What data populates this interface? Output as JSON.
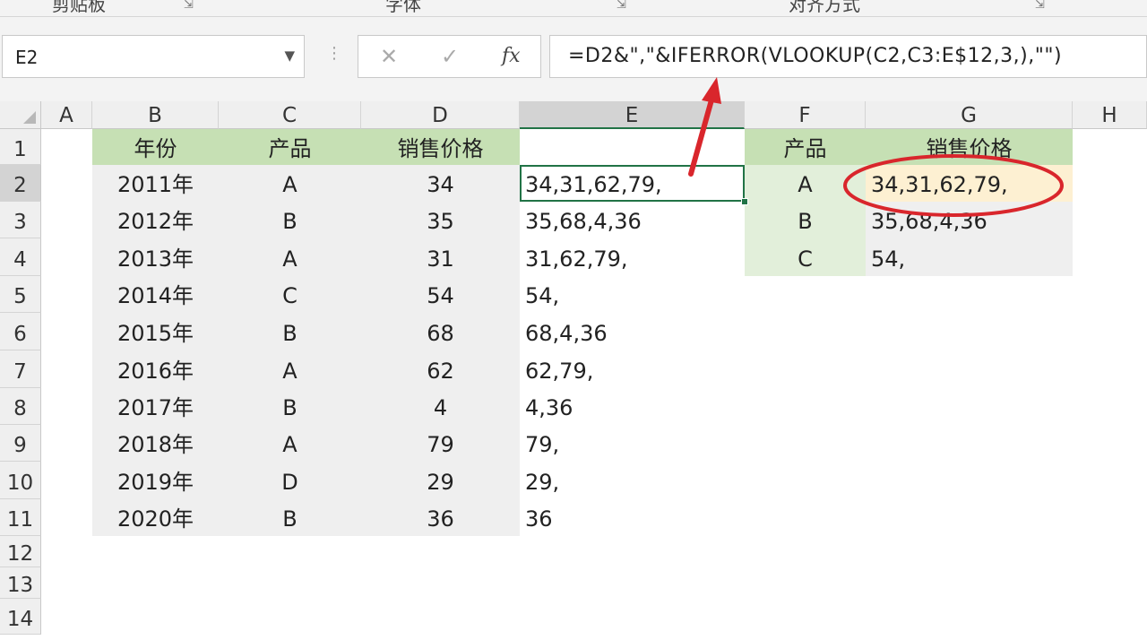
{
  "ribbon": {
    "groups": [
      "剪贴板",
      "字体",
      "对齐方式"
    ]
  },
  "formula_bar": {
    "name_box": "E2",
    "cancel_symbol": "✕",
    "enter_symbol": "✓",
    "fx_label": "fx",
    "formula": "=D2&\",\"&IFERROR(VLOOKUP(C2,C3:E$12,3,),\"\")"
  },
  "columns": [
    "A",
    "B",
    "C",
    "D",
    "E",
    "F",
    "G",
    "H"
  ],
  "rows": [
    "1",
    "2",
    "3",
    "4",
    "5",
    "6",
    "7",
    "8",
    "9",
    "10",
    "11",
    "12",
    "13",
    "14"
  ],
  "table": {
    "headers": [
      "年份",
      "产品",
      "销售价格"
    ],
    "records": [
      {
        "year": "2011年",
        "product": "A",
        "price": "34",
        "result": "34,31,62,79,"
      },
      {
        "year": "2012年",
        "product": "B",
        "price": "35",
        "result": "35,68,4,36"
      },
      {
        "year": "2013年",
        "product": "A",
        "price": "31",
        "result": "31,62,79,"
      },
      {
        "year": "2014年",
        "product": "C",
        "price": "54",
        "result": "54,"
      },
      {
        "year": "2015年",
        "product": "B",
        "price": "68",
        "result": "68,4,36"
      },
      {
        "year": "2016年",
        "product": "A",
        "price": "62",
        "result": "62,79,"
      },
      {
        "year": "2017年",
        "product": "B",
        "price": "4",
        "result": "4,36"
      },
      {
        "year": "2018年",
        "product": "A",
        "price": "79",
        "result": "79,"
      },
      {
        "year": "2019年",
        "product": "D",
        "price": "29",
        "result": "29,"
      },
      {
        "year": "2020年",
        "product": "B",
        "price": "36",
        "result": "36"
      }
    ]
  },
  "lookup": {
    "headers": [
      "产品",
      "销售价格"
    ],
    "records": [
      {
        "product": "A",
        "prices": "34,31,62,79,"
      },
      {
        "product": "B",
        "prices": "35,68,4,36"
      },
      {
        "product": "C",
        "prices": "54,"
      }
    ]
  },
  "colors": {
    "header_fill": "#c6e0b4",
    "data_fill": "#efefef",
    "lookup_product_fill": "#e2efda",
    "selection_border": "#217346",
    "annotation_red": "#d9262c"
  }
}
